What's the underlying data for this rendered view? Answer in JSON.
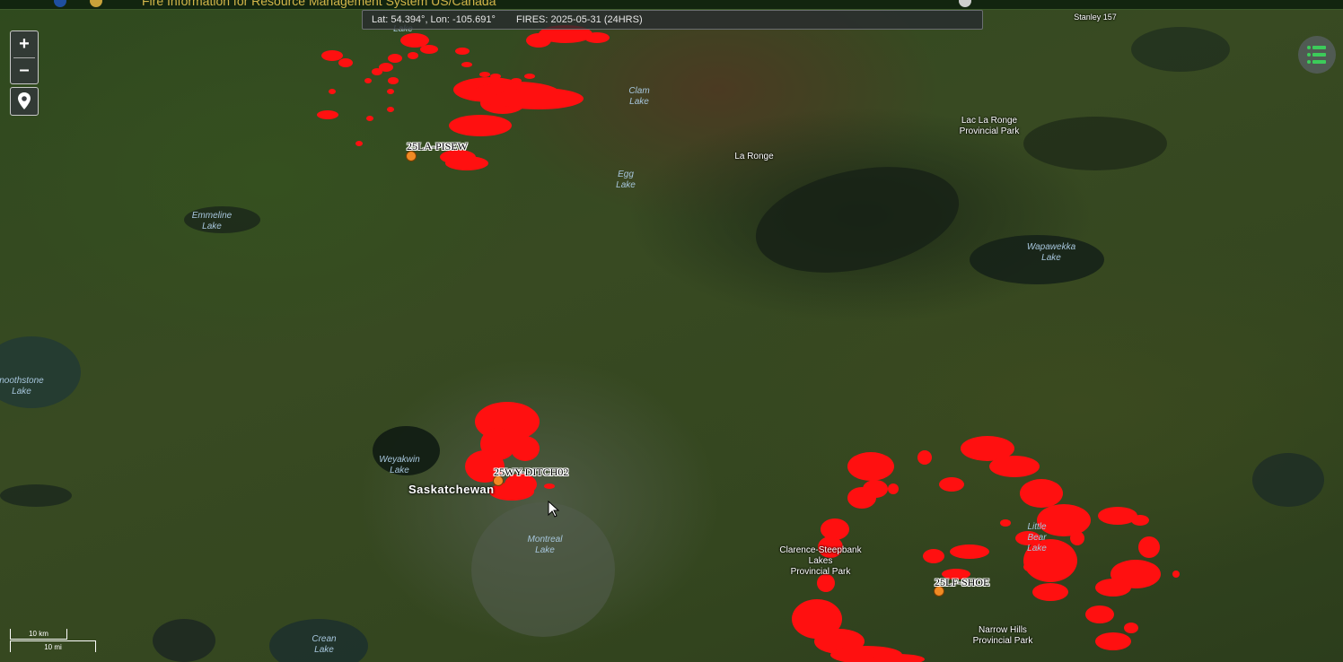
{
  "header": {
    "title": "Fire Information for Resource Management System US/Canada"
  },
  "info_bar": {
    "coords": "Lat: 54.394°, Lon: -105.691°",
    "fires": "FIRES: 2025-05-31 (24HRS)"
  },
  "controls": {
    "zoom_in": "+",
    "zoom_out": "–",
    "locate_icon": "map-pin-icon",
    "layers_icon": "layer-list-icon"
  },
  "places": {
    "lake_top": "Lake",
    "stanley": "Stanley 157",
    "clam_lake": [
      "Clam",
      "Lake"
    ],
    "lac_la_ronge": [
      "Lac La Ronge",
      "Provincial Park"
    ],
    "la_ronge": "La Ronge",
    "egg_lake": [
      "Egg",
      "Lake"
    ],
    "emmeline_lake": [
      "Emmeline",
      "Lake"
    ],
    "wapawekka_lake": [
      "Wapawekka",
      "Lake"
    ],
    "smoothstone_lake": [
      "noothstone",
      "Lake"
    ],
    "weyakwin_lake": [
      "Weyakwin",
      "Lake"
    ],
    "saskatchewan": "Saskatchewan",
    "montreal_lake": [
      "Montreal",
      "Lake"
    ],
    "clarence_steepbank": [
      "Clarence-Steepbank",
      "Lakes",
      "Provincial Park"
    ],
    "little_bear_lake": [
      "Little",
      "Bear",
      "Lake"
    ],
    "narrow_hills": [
      "Narrow Hills",
      "Provincial Park"
    ],
    "crean_lake": [
      "Crean",
      "Lake"
    ]
  },
  "fires": [
    {
      "name": "25LA-PISEW"
    },
    {
      "name": "25WY-DITCH02"
    },
    {
      "name": "25LF-SHOE"
    }
  ],
  "scale": {
    "km": "10 km",
    "mi": "10 mi"
  },
  "colors": {
    "hotspot": "#ff1010",
    "fire_marker": "#f08a24",
    "header_text": "#d3b64a",
    "water_label": "#a7c6dd"
  }
}
